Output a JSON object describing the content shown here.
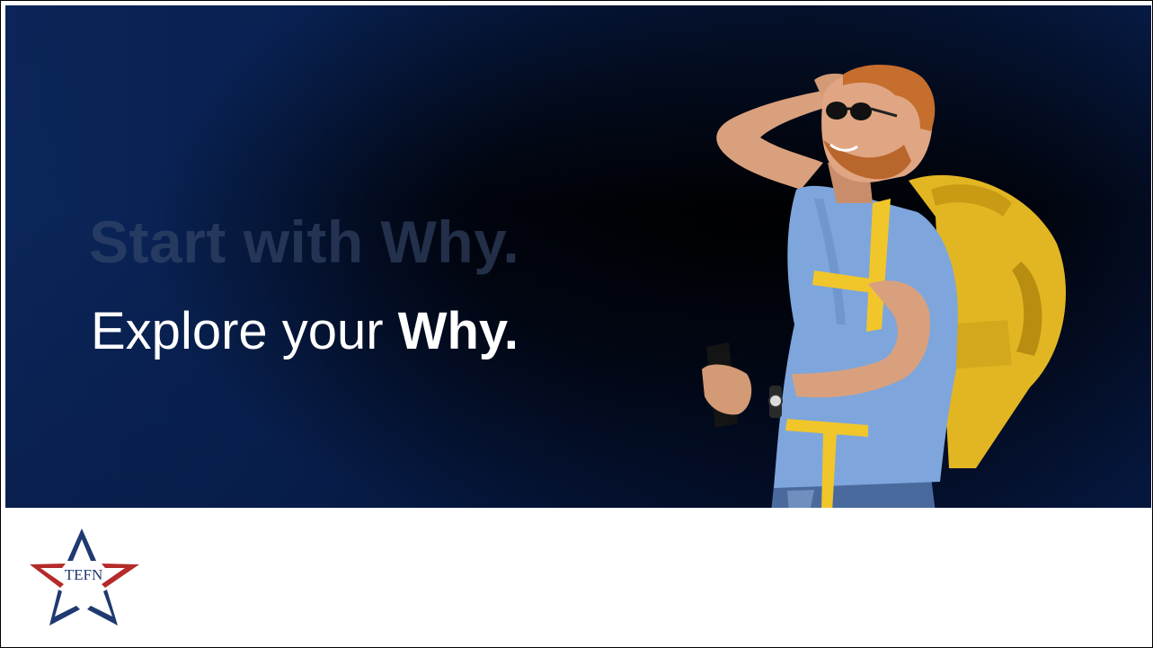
{
  "slide": {
    "ghost_headline": "Start with Why.",
    "headline_prefix": "Explore your ",
    "headline_emphasis": "Why.",
    "logo_text": "TEFN"
  },
  "colors": {
    "banner_dark": "#000000",
    "banner_navy": "#0b2659",
    "ghost_text": "#3a4b6d",
    "headline_text": "#ffffff",
    "logo_blue": "#1f3a70",
    "logo_red": "#b52a2a"
  },
  "image": {
    "subject": "hiker-with-backpack-and-sunglasses"
  }
}
